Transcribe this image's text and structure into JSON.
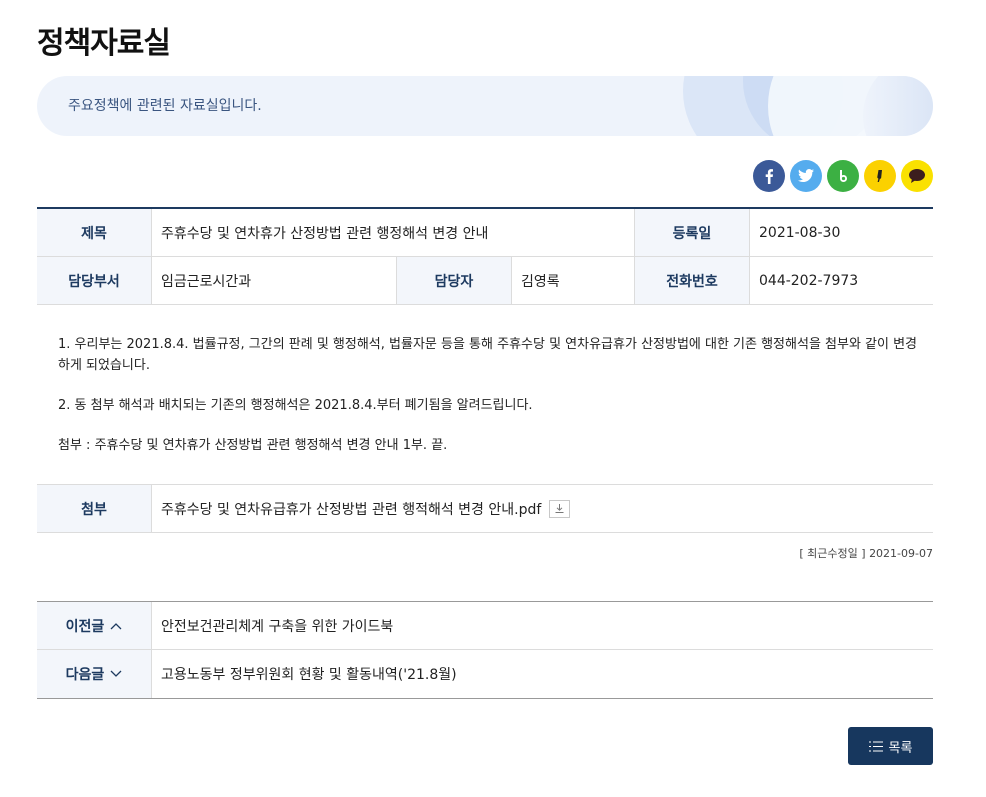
{
  "page": {
    "title": "정책자료실"
  },
  "banner": {
    "text": "주요정책에 관련된 자료실입니다."
  },
  "share": [
    {
      "name": "facebook",
      "color": "#3b5998"
    },
    {
      "name": "twitter",
      "color": "#55acee"
    },
    {
      "name": "band",
      "color": "#3cb043"
    },
    {
      "name": "kakaostory",
      "color": "#fbd100"
    },
    {
      "name": "kakaotalk",
      "color": "#fae100"
    }
  ],
  "info": {
    "title_label": "제목",
    "title_value": "주휴수당 및 연차휴가 산정방법 관련 행정해석 변경 안내",
    "date_label": "등록일",
    "date_value": "2021-08-30",
    "dept_label": "담당부서",
    "dept_value": "임금근로시간과",
    "manager_label": "담당자",
    "manager_value": "김영록",
    "phone_label": "전화번호",
    "phone_value": "044-202-7973"
  },
  "content": {
    "p1": "1. 우리부는 2021.8.4. 법률규정, 그간의 판례 및 행정해석, 법률자문 등을 통해 주휴수당 및 연차유급휴가 산정방법에 대한 기존 행정해석을 첨부와 같이 변경하게 되었습니다.",
    "p2": "2. 동 첨부 해석과 배치되는 기존의 행정해석은 2021.8.4.부터 폐기됨을 알려드립니다.",
    "p3": "첨부 : 주휴수당 및 연차휴가 산정방법 관련 행정해석 변경 안내 1부.  끝."
  },
  "attachment": {
    "label": "첨부",
    "filename": "주휴수당 및 연차유급휴가 산정방법 관련 행적해석 변경 안내.pdf"
  },
  "updated": {
    "text": "[ 최근수정일 ] 2021-09-07"
  },
  "nav": {
    "prev_label": "이전글",
    "prev_title": "안전보건관리체계 구축을 위한 가이드북",
    "next_label": "다음글",
    "next_title": "고용노동부 정부위원회 현황 및 활동내역('21.8월)"
  },
  "buttons": {
    "list_label": "목록"
  },
  "colors": {
    "navy": "#17375e",
    "header_bg": "#f3f6fb",
    "banner_bg": "#eef3fb"
  }
}
